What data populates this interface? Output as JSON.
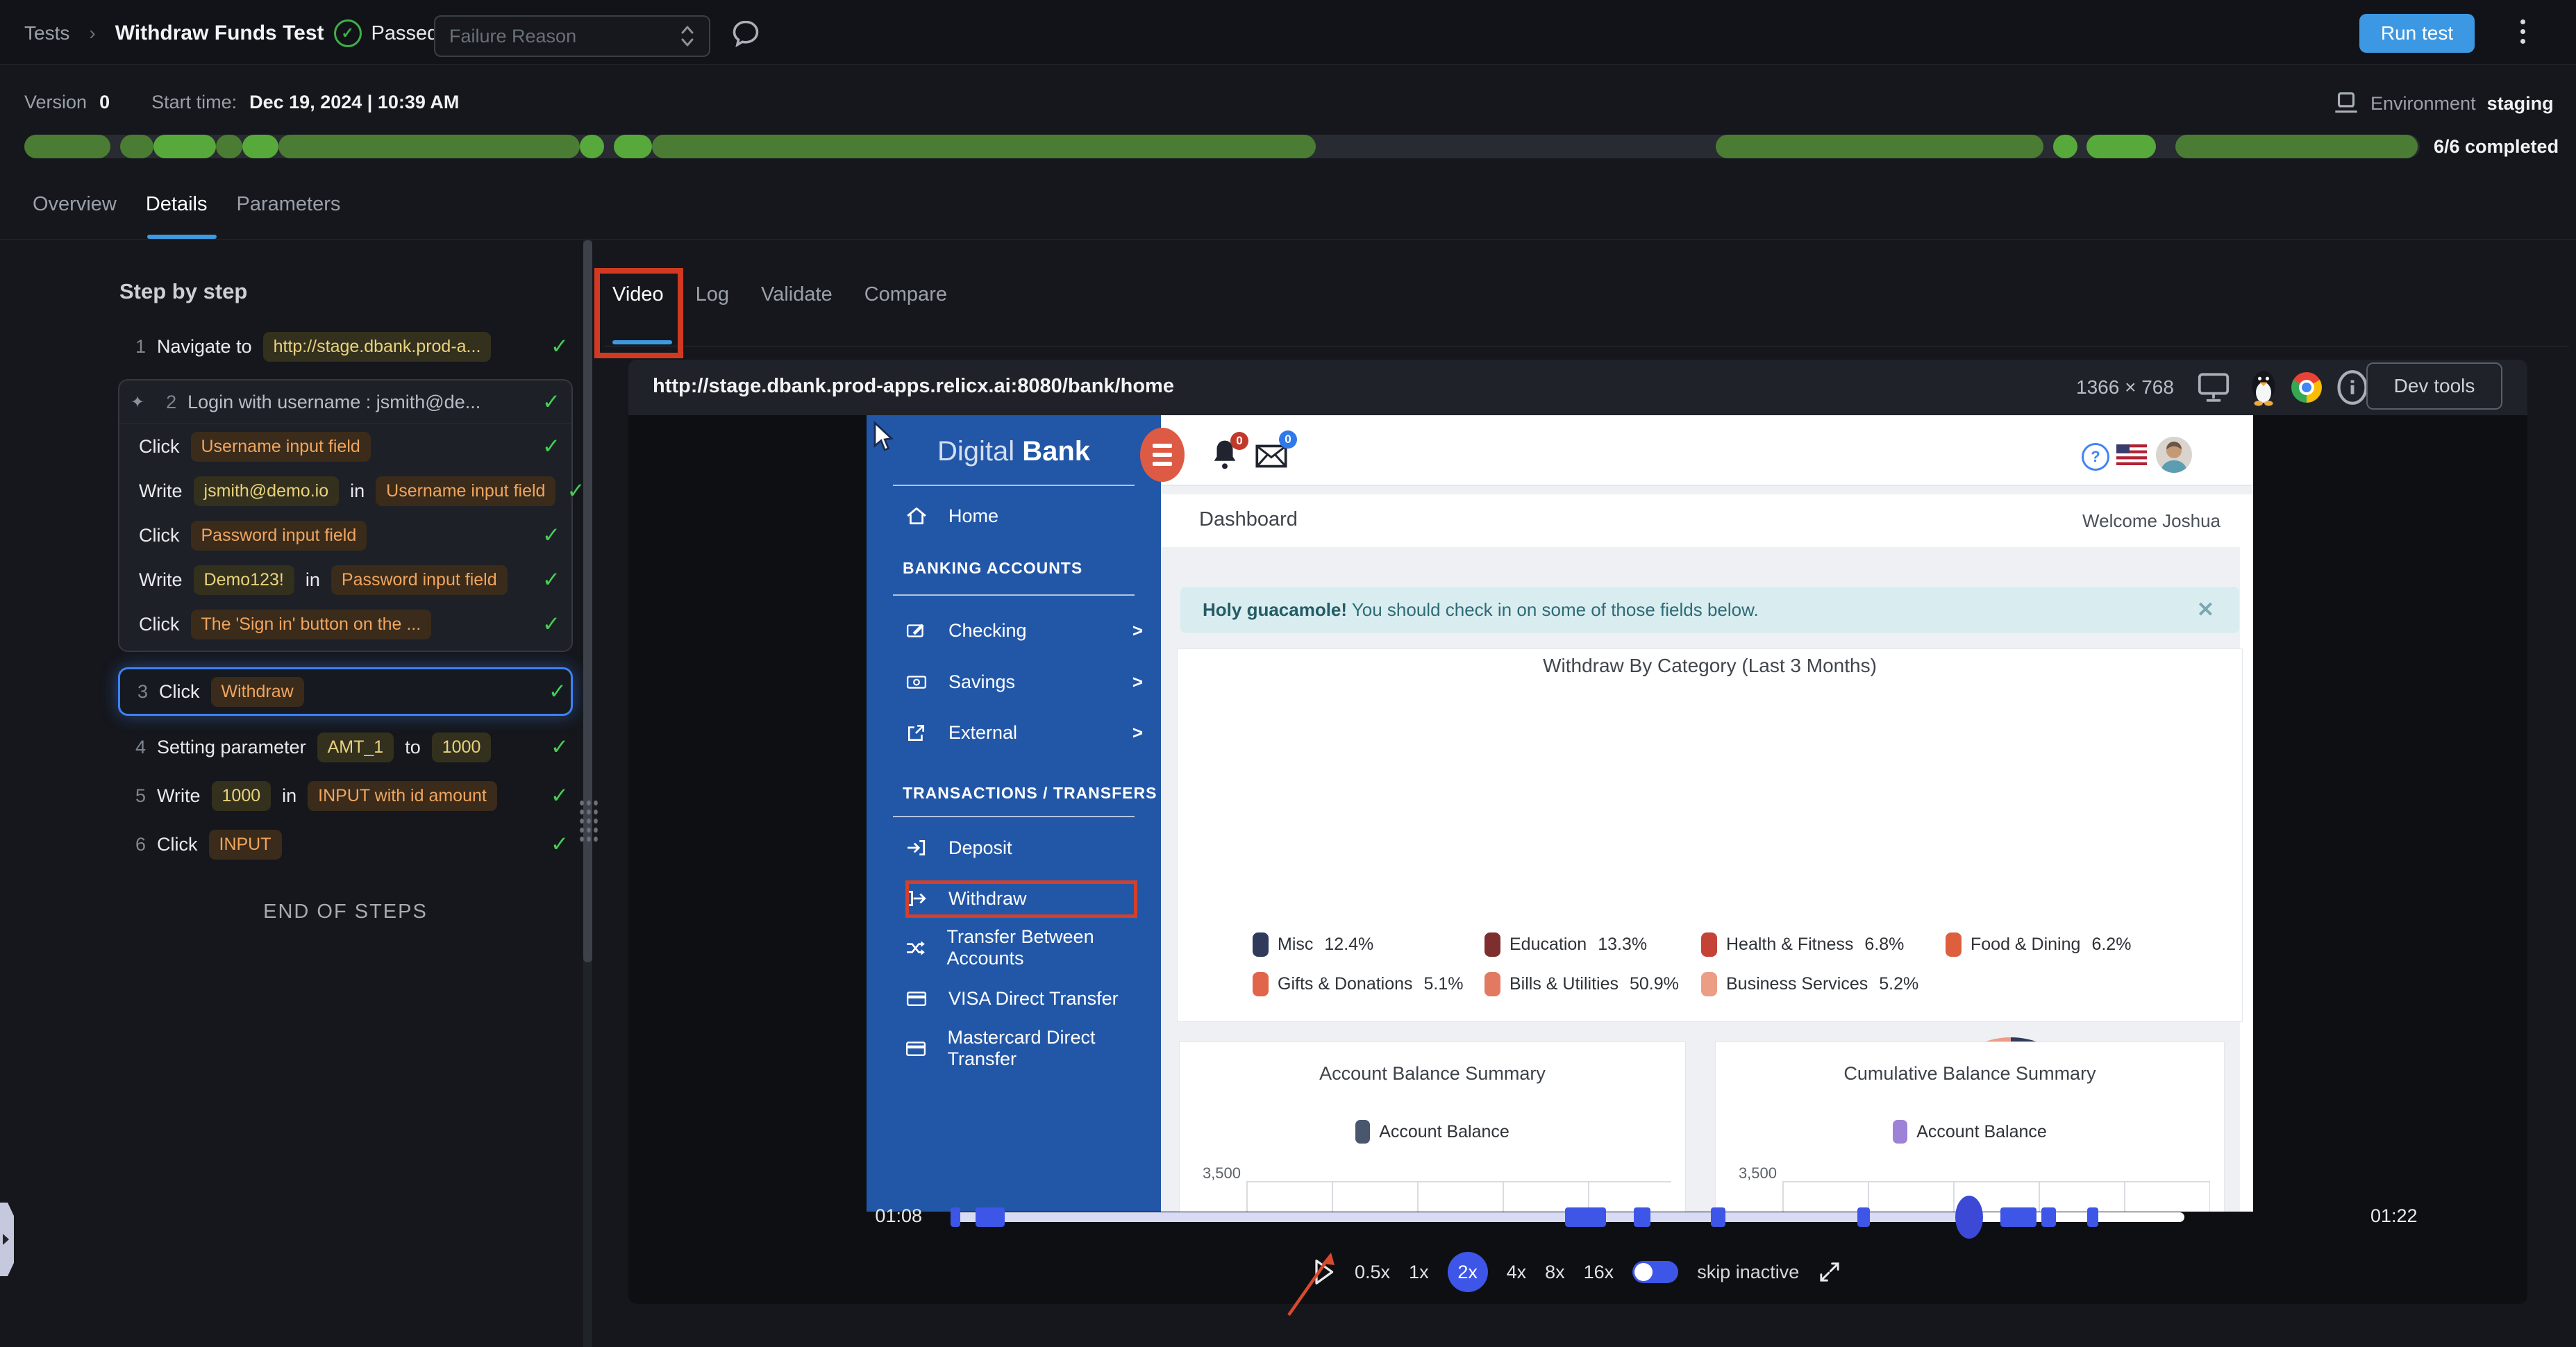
{
  "icons": {
    "check": "✓",
    "sparkle": "✦",
    "crumb_sep": "›",
    "close": "✕",
    "kebab": "⋮"
  },
  "colors": {
    "accent_blue": "#3d9ae1",
    "run_button": "#3d98e3",
    "progress_dark": "#4a7d33",
    "progress_bright": "#57a93c",
    "check_green": "#43d052",
    "highlight_border": "#3b82f6",
    "annotation_red": "#d3402b",
    "player_blue": "#3d56e8",
    "bank_sidebar": "#2257a8",
    "bank_brand_circle": "#dd5b45"
  },
  "topbar": {
    "breadcrumb_root": "Tests",
    "title": "Withdraw Funds Test",
    "status": "Passed",
    "failure_reason_placeholder": "Failure Reason",
    "run_button": "Run test"
  },
  "meta": {
    "version_label": "Version",
    "version_value": "0",
    "start_label": "Start time:",
    "start_value": "Dec 19, 2024 | 10:39 AM",
    "environment_label": "Environment",
    "environment_value": "staging",
    "completed_label": "6/6 completed"
  },
  "progress_segments": [
    {
      "left": 0.0,
      "width": 3.6,
      "shade": "dark"
    },
    {
      "left": 4.0,
      "width": 1.4,
      "shade": "dark"
    },
    {
      "left": 5.4,
      "width": 2.6,
      "shade": "bright"
    },
    {
      "left": 8.0,
      "width": 1.1,
      "shade": "dark"
    },
    {
      "left": 9.1,
      "width": 1.5,
      "shade": "bright"
    },
    {
      "left": 10.6,
      "width": 12.6,
      "shade": "dark"
    },
    {
      "left": 23.2,
      "width": 1.0,
      "shade": "bright"
    },
    {
      "left": 24.6,
      "width": 1.6,
      "shade": "bright"
    },
    {
      "left": 26.2,
      "width": 27.7,
      "shade": "dark"
    },
    {
      "left": 70.6,
      "width": 13.7,
      "shade": "dark"
    },
    {
      "left": 84.7,
      "width": 1.0,
      "shade": "bright"
    },
    {
      "left": 86.1,
      "width": 2.9,
      "shade": "bright"
    },
    {
      "left": 89.8,
      "width": 10.1,
      "shade": "dark"
    }
  ],
  "main_tabs": {
    "items": [
      "Overview",
      "Details",
      "Parameters"
    ],
    "active": "Details"
  },
  "steps": {
    "heading": "Step by step",
    "end_label": "END OF STEPS",
    "rows": [
      {
        "kind": "plain",
        "num": "1",
        "parts": [
          {
            "t": "text",
            "v": "Navigate to"
          },
          {
            "t": "y",
            "v": "http://stage.dbank.prod-a..."
          }
        ]
      },
      {
        "kind": "group",
        "header": {
          "num": "2",
          "label": "Login with username : jsmith@de..."
        },
        "children": [
          {
            "parts": [
              {
                "t": "text",
                "v": "Click"
              },
              {
                "t": "o",
                "v": "Username input field"
              }
            ]
          },
          {
            "parts": [
              {
                "t": "text",
                "v": "Write"
              },
              {
                "t": "y",
                "v": "jsmith@demo.io"
              },
              {
                "t": "text",
                "v": "in"
              },
              {
                "t": "o",
                "v": "Username input field"
              }
            ]
          },
          {
            "parts": [
              {
                "t": "text",
                "v": "Click"
              },
              {
                "t": "o",
                "v": "Password input field"
              }
            ]
          },
          {
            "parts": [
              {
                "t": "text",
                "v": "Write"
              },
              {
                "t": "y",
                "v": "Demo123!"
              },
              {
                "t": "text",
                "v": "in"
              },
              {
                "t": "o",
                "v": "Password input field"
              }
            ]
          },
          {
            "parts": [
              {
                "t": "text",
                "v": "Click"
              },
              {
                "t": "o",
                "v": "The 'Sign in' button on the ..."
              }
            ]
          }
        ]
      },
      {
        "kind": "highlight",
        "num": "3",
        "parts": [
          {
            "t": "text",
            "v": "Click"
          },
          {
            "t": "o",
            "v": "Withdraw"
          }
        ]
      },
      {
        "kind": "tail",
        "num": "4",
        "parts": [
          {
            "t": "text",
            "v": "Setting parameter"
          },
          {
            "t": "y",
            "v": "AMT_1"
          },
          {
            "t": "text",
            "v": "to"
          },
          {
            "t": "y",
            "v": "1000"
          }
        ]
      },
      {
        "kind": "tail",
        "num": "5",
        "parts": [
          {
            "t": "text",
            "v": "Write"
          },
          {
            "t": "y",
            "v": "1000"
          },
          {
            "t": "text",
            "v": "in"
          },
          {
            "t": "o",
            "v": "INPUT with id amount"
          }
        ]
      },
      {
        "kind": "tail",
        "num": "6",
        "parts": [
          {
            "t": "text",
            "v": "Click"
          },
          {
            "t": "o",
            "v": "INPUT"
          }
        ]
      }
    ]
  },
  "detail_tabs": {
    "items": [
      "Video",
      "Log",
      "Validate",
      "Compare"
    ],
    "active": "Video"
  },
  "video_header": {
    "url": "http://stage.dbank.prod-apps.relicx.ai:8080/bank/home",
    "resolution": "1366 × 768",
    "devtools_button": "Dev tools"
  },
  "bank": {
    "logo_light": "Digital ",
    "logo_bold": "Bank",
    "home_label": "Home",
    "bell_badge": "0",
    "mail_badge": "0",
    "sections": [
      {
        "title": "BANKING ACCOUNTS",
        "items": [
          {
            "label": "Checking",
            "icon": "edit-icon",
            "chevron": "❯"
          },
          {
            "label": "Savings",
            "icon": "cash-icon",
            "chevron": "❯"
          },
          {
            "label": "External",
            "icon": "external-link-icon",
            "chevron": "❯"
          }
        ]
      },
      {
        "title": "TRANSACTIONS / TRANSFERS",
        "items": [
          {
            "label": "Deposit",
            "icon": "deposit-icon"
          },
          {
            "label": "Withdraw",
            "icon": "withdraw-icon"
          },
          {
            "label": "Transfer Between Accounts",
            "icon": "shuffle-icon"
          },
          {
            "label": "VISA Direct Transfer",
            "icon": "credit-card-icon"
          },
          {
            "label": "Mastercard Direct Transfer",
            "icon": "credit-card-icon"
          }
        ]
      }
    ],
    "page_title": "Dashboard",
    "welcome": "Welcome Joshua",
    "alert": {
      "bold": "Holy guacamole!",
      "rest": " You should check in on some of those fields below.",
      "close": "✕"
    }
  },
  "chart_data": [
    {
      "type": "pie",
      "title": "Withdraw By Category (Last 3 Months)",
      "labels": [
        "Misc",
        "Education",
        "Health & Fitness",
        "Food & Dining",
        "Gifts & Donations",
        "Bills & Utilities",
        "Business Services"
      ],
      "values": [
        12.4,
        13.3,
        6.8,
        6.2,
        5.1,
        50.9,
        5.2
      ],
      "colors": [
        "#303b5b",
        "#7e2e2e",
        "#c44336",
        "#de5f3d",
        "#e0654b",
        "#e27a61",
        "#eb9d86"
      ],
      "legend_position": "top",
      "legend_rows": [
        [
          0,
          1,
          2,
          3
        ],
        [
          4,
          5,
          6
        ]
      ]
    },
    {
      "type": "bar",
      "title": "Account Balance Summary",
      "series": [
        {
          "name": "Account Balance"
        }
      ],
      "legend_color": "#4a566e",
      "visible_ticks": [
        "3,500"
      ],
      "note": "chart cropped by video viewport"
    },
    {
      "type": "bar",
      "title": "Cumulative Balance Summary",
      "series": [
        {
          "name": "Account Balance"
        }
      ],
      "legend_color": "#9d82d8",
      "visible_ticks": [
        "3,500"
      ],
      "note": "chart cropped by video viewport"
    }
  ],
  "player": {
    "current_time": "01:08",
    "total_time": "01:22",
    "playhead_pct": 82.6,
    "track_played_color": "#d7dbf4",
    "track_rest_color": "#ffffff",
    "markers": [
      {
        "left": 0.0,
        "width": 0.8
      },
      {
        "left": 2.0,
        "width": 2.4
      },
      {
        "left": 49.8,
        "width": 3.3
      },
      {
        "left": 55.4,
        "width": 1.3
      },
      {
        "left": 61.6,
        "width": 1.2
      },
      {
        "left": 73.5,
        "width": 1.0
      },
      {
        "left": 85.1,
        "width": 2.9
      },
      {
        "left": 88.4,
        "width": 1.2
      },
      {
        "left": 92.1,
        "width": 0.9
      }
    ],
    "speeds": [
      "0.5x",
      "1x",
      "2x",
      "4x",
      "8x",
      "16x"
    ],
    "active_speed": "2x",
    "skip_label": "skip inactive"
  }
}
